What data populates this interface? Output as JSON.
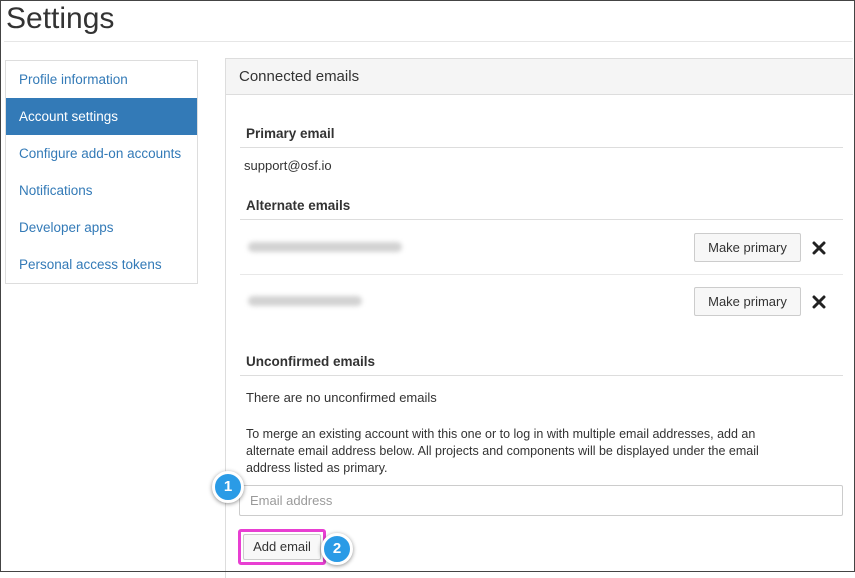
{
  "page": {
    "title": "Settings"
  },
  "sidebar": {
    "items": [
      {
        "label": "Profile information",
        "active": false
      },
      {
        "label": "Account settings",
        "active": true
      },
      {
        "label": "Configure add-on accounts",
        "active": false
      },
      {
        "label": "Developer apps",
        "active": false
      },
      {
        "label": "Personal access tokens",
        "active": false
      }
    ],
    "notifications_label": "Notifications"
  },
  "panel": {
    "title": "Connected emails",
    "primary": {
      "title": "Primary email",
      "email": "support@osf.io"
    },
    "alternate": {
      "title": "Alternate emails",
      "make_primary_label": "Make primary"
    },
    "unconfirmed": {
      "title": "Unconfirmed emails",
      "empty_text": "There are no unconfirmed emails"
    },
    "merge_text": "To merge an existing account with this one or to log in with multiple email addresses, add an alternate email address below. All projects and components will be displayed under the email address listed as primary.",
    "email_input": {
      "placeholder": "Email address",
      "value": ""
    },
    "add_button_label": "Add email"
  },
  "annotations": {
    "badge_1": "1",
    "badge_2": "2"
  },
  "colors": {
    "accent": "#337ab7",
    "highlight": "#e83fd2",
    "badge": "#2a9be6"
  }
}
